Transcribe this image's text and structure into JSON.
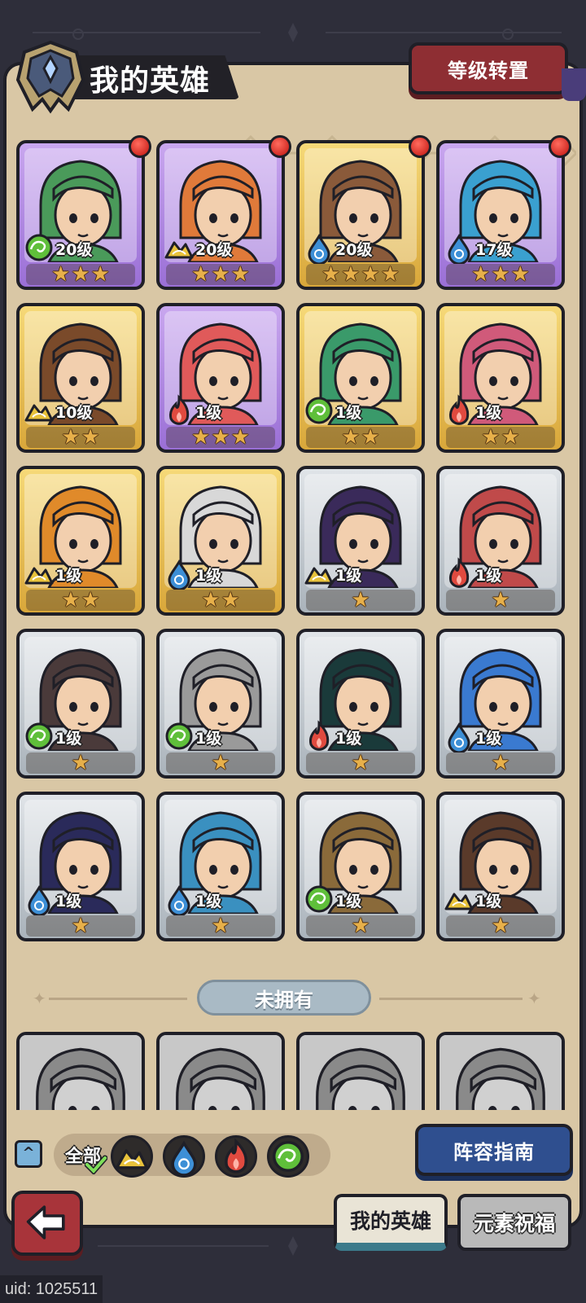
{
  "header": {
    "title": "我的英雄",
    "level_reset_label": "等级转置"
  },
  "colors": {
    "panel": "#d9c7a5",
    "purple_rarity": "#a37ce0",
    "gold_rarity": "#e6bb4f",
    "silver_rarity": "#c4cbd2",
    "wind": "#5fbf3a",
    "earth": "#e8c23b",
    "water": "#3d8fd6",
    "fire": "#e04a3f"
  },
  "heroes": [
    {
      "level": "20级",
      "stars": 3,
      "element": "wind-icon",
      "rarity": "purple",
      "badge": true,
      "hue": "#4a9a5a"
    },
    {
      "level": "20级",
      "stars": 3,
      "element": "earth-icon",
      "rarity": "purple",
      "badge": true,
      "hue": "#e07a3a"
    },
    {
      "level": "20级",
      "stars": 4,
      "element": "water-icon",
      "rarity": "gold",
      "badge": true,
      "hue": "#8a5a3a"
    },
    {
      "level": "17级",
      "stars": 3,
      "element": "water-icon",
      "rarity": "purple",
      "badge": true,
      "hue": "#3aa0d0"
    },
    {
      "level": "10级",
      "stars": 2,
      "element": "earth-icon",
      "rarity": "gold",
      "badge": false,
      "hue": "#7a4a2a"
    },
    {
      "level": "1级",
      "stars": 3,
      "element": "fire-icon",
      "rarity": "purple",
      "badge": false,
      "hue": "#e05a5a"
    },
    {
      "level": "1级",
      "stars": 2,
      "element": "wind-icon",
      "rarity": "gold",
      "badge": false,
      "hue": "#3a9a6a"
    },
    {
      "level": "1级",
      "stars": 2,
      "element": "fire-icon",
      "rarity": "gold",
      "badge": false,
      "hue": "#d05a7a"
    },
    {
      "level": "1级",
      "stars": 2,
      "element": "earth-icon",
      "rarity": "gold",
      "badge": false,
      "hue": "#e08a2a"
    },
    {
      "level": "1级",
      "stars": 2,
      "element": "water-icon",
      "rarity": "gold",
      "badge": false,
      "hue": "#d8d8d8"
    },
    {
      "level": "1级",
      "stars": 1,
      "element": "earth-icon",
      "rarity": "silver",
      "badge": false,
      "hue": "#3a2a5a"
    },
    {
      "level": "1级",
      "stars": 1,
      "element": "fire-icon",
      "rarity": "silver",
      "badge": false,
      "hue": "#c04a4a"
    },
    {
      "level": "1级",
      "stars": 1,
      "element": "wind-icon",
      "rarity": "silver",
      "badge": false,
      "hue": "#4a3a3a"
    },
    {
      "level": "1级",
      "stars": 1,
      "element": "wind-icon",
      "rarity": "silver",
      "badge": false,
      "hue": "#9a9a9a"
    },
    {
      "level": "1级",
      "stars": 1,
      "element": "fire-icon",
      "rarity": "silver",
      "badge": false,
      "hue": "#1a3a3a"
    },
    {
      "level": "1级",
      "stars": 1,
      "element": "water-icon",
      "rarity": "silver",
      "badge": false,
      "hue": "#3a7ad0"
    },
    {
      "level": "1级",
      "stars": 1,
      "element": "water-icon",
      "rarity": "silver",
      "badge": false,
      "hue": "#2a2a5a"
    },
    {
      "level": "1级",
      "stars": 1,
      "element": "water-icon",
      "rarity": "silver",
      "badge": false,
      "hue": "#3a90c0"
    },
    {
      "level": "1级",
      "stars": 1,
      "element": "wind-icon",
      "rarity": "silver",
      "badge": false,
      "hue": "#8a6a3a"
    },
    {
      "level": "1级",
      "stars": 1,
      "element": "earth-icon",
      "rarity": "silver",
      "badge": false,
      "hue": "#5a3a2a"
    }
  ],
  "unowned": {
    "label": "未拥有",
    "count_visible": 4
  },
  "filter": {
    "all_label": "全部",
    "elements": [
      "earth-icon",
      "water-icon",
      "fire-icon",
      "wind-icon"
    ]
  },
  "lineup_guide_label": "阵容指南",
  "tabs": {
    "my_heroes": "我的英雄",
    "element_blessing": "元素祝福"
  },
  "uid": "uid: 1025511"
}
